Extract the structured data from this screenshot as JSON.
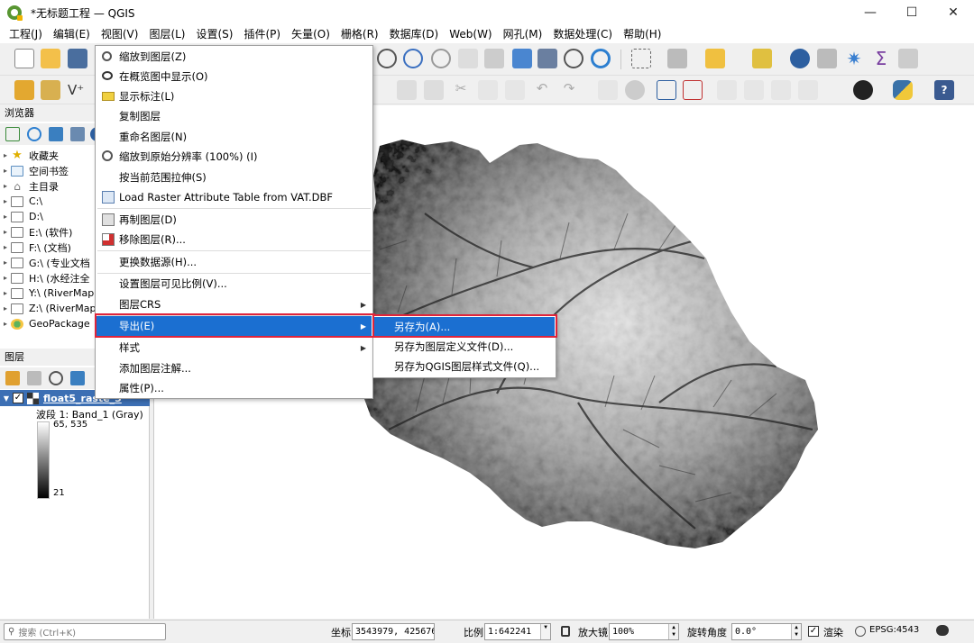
{
  "window": {
    "title": "*无标题工程 — QGIS",
    "minimize": "—",
    "maximize": "☐",
    "close": "✕"
  },
  "menubar": {
    "items": [
      "工程(J)",
      "编辑(E)",
      "视图(V)",
      "图层(L)",
      "设置(S)",
      "插件(P)",
      "矢量(O)",
      "栅格(R)",
      "数据库(D)",
      "Web(W)",
      "网孔(M)",
      "数据处理(C)",
      "帮助(H)"
    ]
  },
  "browser_panel": {
    "title": "浏览器",
    "items": [
      {
        "label": "收藏夹",
        "icon": "star-icon"
      },
      {
        "label": "空间书签",
        "icon": "bookmark-icon"
      },
      {
        "label": "主目录",
        "icon": "home-icon"
      },
      {
        "label": "C:\\",
        "icon": "folder-icon"
      },
      {
        "label": "D:\\",
        "icon": "folder-icon"
      },
      {
        "label": "E:\\ (软件)",
        "icon": "folder-icon"
      },
      {
        "label": "F:\\ (文档)",
        "icon": "folder-icon"
      },
      {
        "label": "G:\\ (专业文档",
        "icon": "folder-icon"
      },
      {
        "label": "H:\\ (水经注全",
        "icon": "folder-icon"
      },
      {
        "label": "Y:\\ (RiverMap",
        "icon": "folder-icon"
      },
      {
        "label": "Z:\\ (RiverMap",
        "icon": "folder-icon"
      },
      {
        "label": "GeoPackage",
        "icon": "geopackage-icon"
      }
    ]
  },
  "layers_panel": {
    "title": "图层",
    "layer_name": "float5_raste_5",
    "band_label": "波段 1: Band_1 (Gray)",
    "legend_max": "65, 535",
    "legend_min": "21"
  },
  "context_menu": {
    "items": [
      {
        "label": "缩放到图层(Z)",
        "icon": "zoom-layer-icon"
      },
      {
        "label": "在概览图中显示(O)",
        "icon": "overview-icon"
      },
      {
        "label": "显示标注(L)",
        "icon": "label-icon"
      },
      {
        "label": "复制图层",
        "icon": ""
      },
      {
        "label": "重命名图层(N)",
        "icon": ""
      },
      {
        "label": "缩放到原始分辨率 (100%) (I)",
        "icon": "zoom-native-icon"
      },
      {
        "label": "按当前范围拉伸(S)",
        "icon": ""
      },
      {
        "label": "Load Raster Attribute Table from VAT.DBF",
        "icon": "table-icon"
      },
      {
        "label": "再制图层(D)",
        "icon": "duplicate-icon"
      },
      {
        "label": "移除图层(R)...",
        "icon": "remove-layer-icon"
      },
      {
        "label": "更换数据源(H)...",
        "icon": ""
      },
      {
        "label": "设置图层可见比例(V)...",
        "icon": ""
      },
      {
        "label": "图层CRS",
        "icon": ""
      },
      {
        "label": "导出(E)",
        "icon": ""
      },
      {
        "label": "样式",
        "icon": ""
      },
      {
        "label": "添加图层注解...",
        "icon": ""
      },
      {
        "label": "属性(P)...",
        "icon": ""
      }
    ]
  },
  "export_submenu": {
    "items": [
      "另存为(A)...",
      "另存为图层定义文件(D)...",
      "另存为QGIS图层样式文件(Q)..."
    ]
  },
  "statusbar": {
    "search_placeholder": "搜索 (Ctrl+K)",
    "coord_label": "坐标",
    "coord_value": "3543979, 425676",
    "scale_label": "比例",
    "scale_value": "1:642241",
    "magnifier_label": "放大镜",
    "magnifier_value": "100%",
    "rotation_label": "旋转角度",
    "rotation_value": "0.0°",
    "render_label": "渲染",
    "crs_label": "EPSG:4543"
  },
  "colors": {
    "highlight": "#1b6fd1",
    "annotation_box": "#e0243a",
    "layer_selected": "#3c6fb4"
  }
}
